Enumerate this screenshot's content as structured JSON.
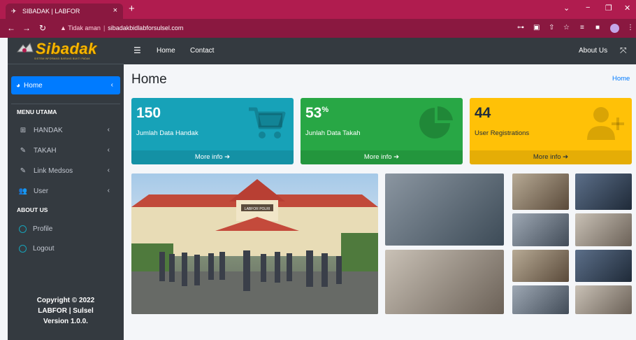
{
  "browser": {
    "tab_title": "SIBADAK | LABFOR",
    "url_warning": "Tidak aman",
    "url": "sibadakbidlabforsulsel.com"
  },
  "brand": {
    "name": "Sibadak",
    "subtitle": "SISTEM INFORMASI BARANG BUKTI PADAK"
  },
  "sidebar": {
    "active_item": "Home",
    "section_main": "MENU UTAMA",
    "items": [
      {
        "label": "HANDAK",
        "icon": "table-icon"
      },
      {
        "label": "TAKAH",
        "icon": "edit-icon"
      },
      {
        "label": "Link Medsos",
        "icon": "edit-icon"
      },
      {
        "label": "User",
        "icon": "users-icon"
      }
    ],
    "section_about": "ABOUT US",
    "about_items": [
      {
        "label": "Profile"
      },
      {
        "label": "Logout"
      }
    ],
    "footer": {
      "line1": "Copyright © 2022",
      "line2": "LABFOR | Sulsel",
      "line3": "Version 1.0.0."
    }
  },
  "topnav": {
    "home": "Home",
    "contact": "Contact",
    "about": "About Us"
  },
  "page": {
    "title": "Home",
    "breadcrumb": "Home"
  },
  "stats": [
    {
      "value": "150",
      "suffix": "",
      "label": "Jumlah Data Handak",
      "more": "More info",
      "color": "#17a2b8",
      "icon": "cart-icon"
    },
    {
      "value": "53",
      "suffix": "%",
      "label": "Junlah Data Takah",
      "more": "More info",
      "color": "#28a745",
      "icon": "pie-chart-icon"
    },
    {
      "value": "44",
      "suffix": "",
      "label": "User Registrations",
      "more": "More info",
      "color": "#ffc107",
      "icon": "user-plus-icon"
    }
  ],
  "gallery": {
    "main_sign": "LABFOR POLRI"
  }
}
